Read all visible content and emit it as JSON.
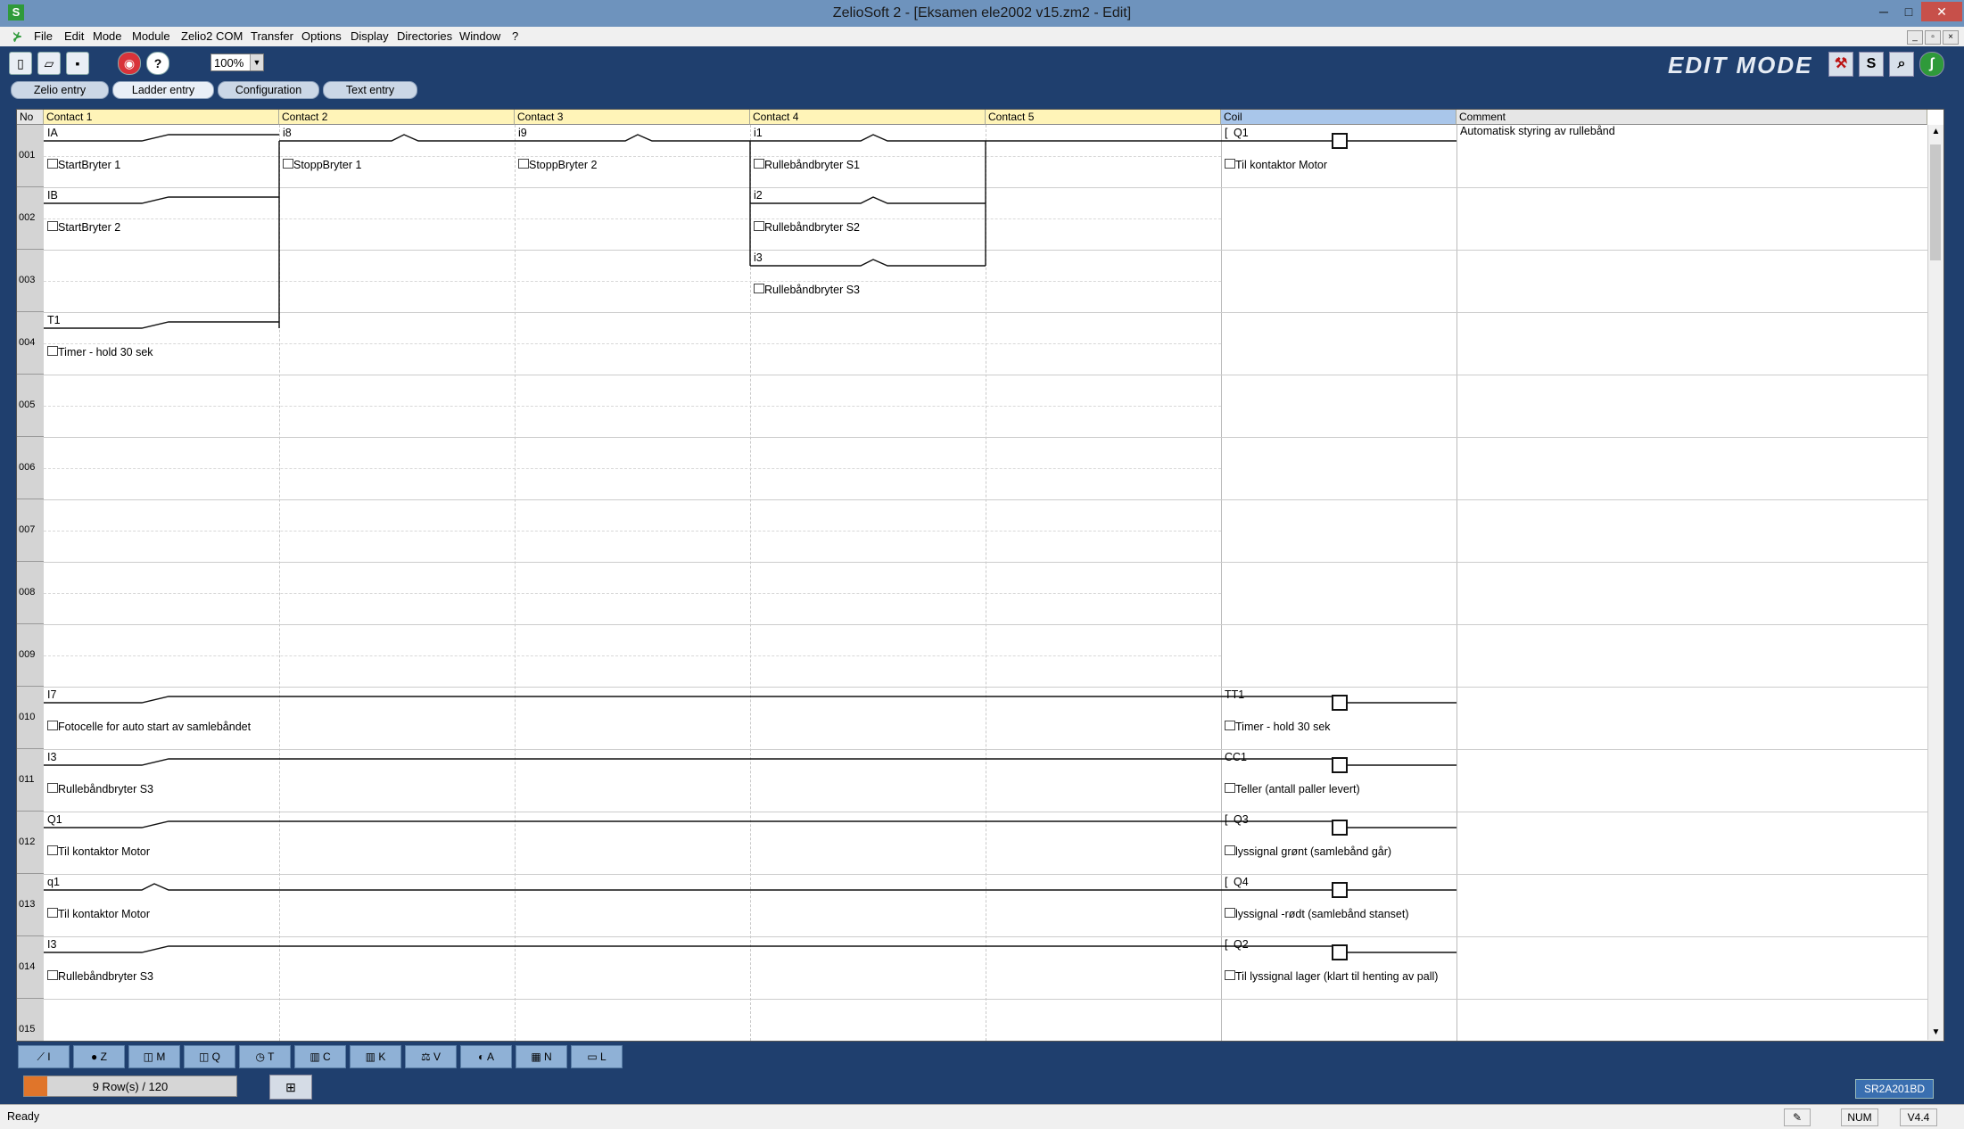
{
  "window": {
    "app_icon": "S",
    "title": "ZelioSoft 2 - [Eksamen ele2002 v15.zm2 - Edit]",
    "minimize": "─",
    "maximize": "□",
    "close": "✕"
  },
  "menu": {
    "items": [
      "File",
      "Edit",
      "Mode",
      "Module",
      "Zelio2 COM",
      "Transfer",
      "Options",
      "Display",
      "Directories",
      "Window",
      "?"
    ]
  },
  "toolbar": {
    "zoom_value": "100%",
    "mode_label": "EDIT MODE"
  },
  "tabs": [
    "Zelio entry",
    "Ladder entry",
    "Configuration",
    "Text entry"
  ],
  "columns": {
    "no": "No",
    "contacts": [
      "Contact 1",
      "Contact 2",
      "Contact 3",
      "Contact 4",
      "Contact 5"
    ],
    "coil": "Coil",
    "comment": "Comment"
  },
  "rows": [
    "001",
    "002",
    "003",
    "004",
    "005",
    "006",
    "007",
    "008",
    "009",
    "010",
    "011",
    "012",
    "013",
    "014",
    "015"
  ],
  "cells": {
    "r001": {
      "c1": {
        "address": "IA",
        "comment": "StartBryter 1"
      },
      "c2": {
        "address": "i8",
        "comment": "StoppBryter 1"
      },
      "c3": {
        "address": "i9",
        "comment": "StoppBryter 2"
      },
      "c4": {
        "address": "i1",
        "comment": "Rullebåndbryter S1"
      },
      "coil": {
        "address": "Q1",
        "comment": "Til kontaktor Motor",
        "prefix": "["
      },
      "rung_comment": "Automatisk styring av rullebånd"
    },
    "r002": {
      "c1": {
        "address": "IB",
        "comment": "StartBryter 2"
      },
      "c4": {
        "address": "i2",
        "comment": "Rullebåndbryter S2"
      }
    },
    "r003": {
      "c4": {
        "address": "i3",
        "comment": "Rullebåndbryter S3"
      }
    },
    "r004": {
      "c1": {
        "address": "T1",
        "comment": "Timer - hold 30 sek"
      }
    },
    "r010": {
      "c1": {
        "address": "I7",
        "comment": "Fotocelle for auto start av samlebåndet"
      },
      "coil": {
        "address": "TT1",
        "comment": "Timer - hold 30 sek"
      }
    },
    "r011": {
      "c1": {
        "address": "I3",
        "comment": "Rullebåndbryter S3"
      },
      "coil": {
        "address": "CC1",
        "comment": "Teller (antall paller levert)"
      }
    },
    "r012": {
      "c1": {
        "address": "Q1",
        "comment": "Til kontaktor Motor"
      },
      "coil": {
        "address": "Q3",
        "comment": "lyssignal grønt (samlebånd går)",
        "prefix": "["
      }
    },
    "r013": {
      "c1": {
        "address": "q1",
        "comment": "Til kontaktor Motor"
      },
      "coil": {
        "address": "Q4",
        "comment": "lyssignal -rødt (samlebånd stanset)",
        "prefix": "["
      }
    },
    "r014": {
      "c1": {
        "address": "I3",
        "comment": "Rullebåndbryter S3"
      },
      "coil": {
        "address": "Q2",
        "comment": "Til lyssignal lager (klart til henting av pall)",
        "prefix": "["
      }
    }
  },
  "palette": [
    "I",
    "Z",
    "M",
    "Q",
    "T",
    "C",
    "K",
    "V",
    "A",
    "N",
    "L"
  ],
  "info": {
    "rows_count": "9 Row(s) / 120",
    "module_ref": "SR2A201BD"
  },
  "status": {
    "text": "Ready",
    "num": "NUM",
    "version": "V4.4"
  },
  "icons": [
    "new-file-icon",
    "open-folder-icon",
    "save-icon",
    "monitor-eye-icon",
    "help-icon",
    "simulation-icon",
    "settings-icon",
    "zoom-icon",
    "brand-logo-icon"
  ],
  "colors": {
    "header_contact": "#fff4b8",
    "header_coil": "#a9c6ea",
    "frame": "#1f3f6e",
    "titlebar": "#6e93bd"
  }
}
